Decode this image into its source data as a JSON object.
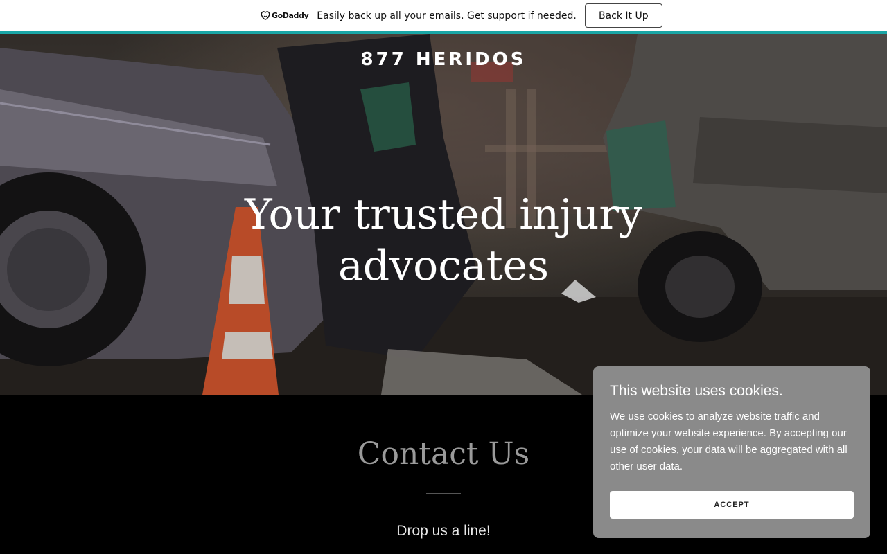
{
  "promo": {
    "logo_text": "GoDaddy",
    "message": "Easily back up all your emails. Get support if needed.",
    "button_label": "Back It Up",
    "accent_color": "#1aa6a6"
  },
  "hero": {
    "brand": "877 HERIDOS",
    "title": "Your trusted injury advocates"
  },
  "contact": {
    "title": "Contact Us",
    "subtitle": "Drop us a line!"
  },
  "cookie": {
    "title": "This website uses cookies.",
    "text": "We use cookies to analyze website traffic and optimize your website experience. By accepting our use of cookies, your data will be aggregated with all other user data.",
    "button_label": "ACCEPT"
  }
}
